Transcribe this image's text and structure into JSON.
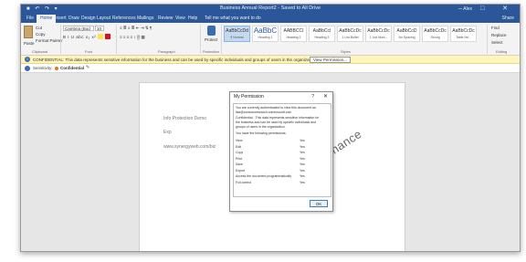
{
  "window": {
    "title": "Business Annual Report2 - Saved to All Drive",
    "account": "Alex",
    "quick_access": "■ ↶ ↷ ▾",
    "window_controls": "– □ ✕"
  },
  "ribbon_tabs": [
    "File",
    "Home",
    "Insert",
    "Draw",
    "Design",
    "Layout",
    "References",
    "Mailings",
    "Review",
    "View",
    "Help"
  ],
  "active_tab": "Home",
  "tell_me": "Tell me what you want to do",
  "share": "Share",
  "ribbon": {
    "clipboard": {
      "paste_label": "Paste",
      "cut": "Cut",
      "copy": "Copy",
      "format_painter": "Format Painter",
      "label": "Clipboard"
    },
    "font": {
      "family": "Cambria (Bod",
      "size": "10",
      "format_row": "B  I  U  abc  x₂  x²  A",
      "label": "Font"
    },
    "paragraph": {
      "row1": "≡ ≣ ≡ ≣  ⇤ ⇥  ⇅  ¶",
      "row2": "≡ ≡ ≡ ≡  ↕  ▒  ▦",
      "label": "Paragraph"
    },
    "protection": {
      "btn": "Protect",
      "label": "Protection"
    },
    "styles": [
      {
        "sample": "AaBbCcDd",
        "name": "¶ Normal"
      },
      {
        "sample": "AaBbC",
        "name": "Heading 1"
      },
      {
        "sample": "AABBCCI",
        "name": "Heading 2"
      },
      {
        "sample": "AaBbCcI",
        "name": "Heading 3"
      },
      {
        "sample": "AaBbCcDc",
        "name": "1 List Bullet"
      },
      {
        "sample": "AaBbCcDc",
        "name": "1 List Num..."
      },
      {
        "sample": "AaBbCcD",
        "name": "No Spacing"
      },
      {
        "sample": "AaBbCcDc",
        "name": "Strong"
      },
      {
        "sample": "AaBbCcDc",
        "name": "Table He..."
      }
    ],
    "styles_label": "Styles",
    "editing": {
      "find": "Find",
      "replace": "Replace",
      "select": "Select",
      "label": "Editing"
    }
  },
  "info_bar": {
    "message": "CONFIDENTIAL: This data represents sensitive information for the business and can be used by specific individuals and groups of users in the organization.",
    "button": "View Permission..."
  },
  "sensitivity": {
    "label": "Sensitivity:",
    "value": "Confidential"
  },
  "document": {
    "lines": [
      "Info Protection Demo",
      "Exp",
      "www.synergyweb.com/biz"
    ],
    "watermark": "Confidential - Finance"
  },
  "dialog": {
    "title": "My Permission",
    "help": "?",
    "close": "✕",
    "intro": [
      "You are currently authenticated to view this document as:",
      "lisa@contosoresearch.onmicrosoft.com",
      "Confidential - This data represents sensitive information for",
      "the business and can be used by specific individuals and",
      "groups of users in the organization."
    ],
    "perm_header": "You have the following permissions:",
    "permissions": [
      {
        "name": "View",
        "value": "Yes"
      },
      {
        "name": "Edit",
        "value": "Yes"
      },
      {
        "name": "Copy",
        "value": "Yes"
      },
      {
        "name": "Print",
        "value": "Yes"
      },
      {
        "name": "Save",
        "value": "Yes"
      },
      {
        "name": "Export",
        "value": "Yes"
      },
      {
        "name": "Access the document programmatically",
        "value": "Yes"
      },
      {
        "name": "Full control",
        "value": "Yes"
      }
    ],
    "ok": "OK"
  }
}
